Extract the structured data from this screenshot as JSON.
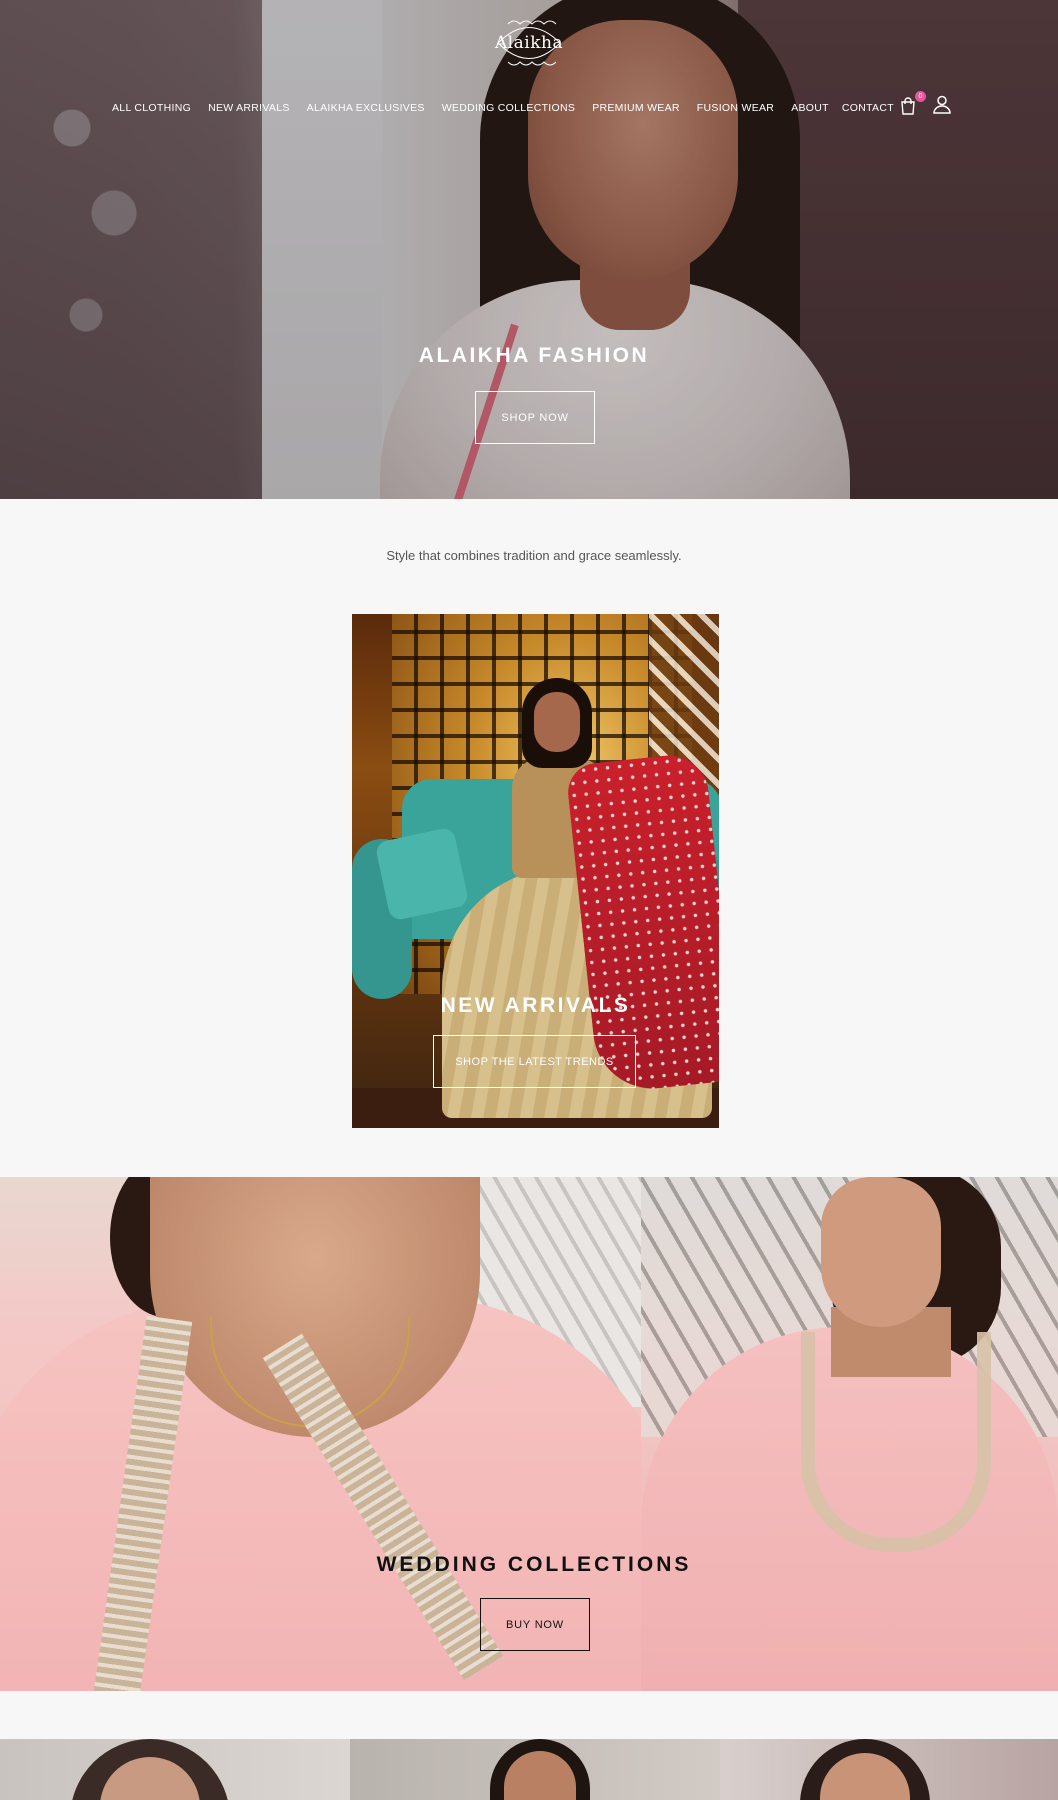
{
  "brand": {
    "logo_text": "Alaikha"
  },
  "nav": {
    "items": [
      {
        "label": "ALL CLOTHING"
      },
      {
        "label": "NEW ARRIVALS"
      },
      {
        "label": "ALAIKHA EXCLUSIVES"
      },
      {
        "label": "WEDDING COLLECTIONS"
      },
      {
        "label": "PREMIUM WEAR"
      },
      {
        "label": "FUSION WEAR"
      },
      {
        "label": "ABOUT"
      },
      {
        "label": "CONTACT"
      }
    ],
    "cart_count": "0",
    "cart_icon": "shopping-bag-icon",
    "account_icon": "user-icon",
    "badge_color": "#e8559a"
  },
  "hero": {
    "title": "ALAIKHA FASHION",
    "button_label": "SHOP NOW"
  },
  "tagline": "Style that combines tradition and grace seamlessly.",
  "new_arrivals": {
    "title": "NEW ARRIVALS",
    "button_label": "SHOP THE LATEST TRENDS"
  },
  "wedding": {
    "title": "WEDDING COLLECTIONS",
    "button_label": "BUY NOW"
  }
}
